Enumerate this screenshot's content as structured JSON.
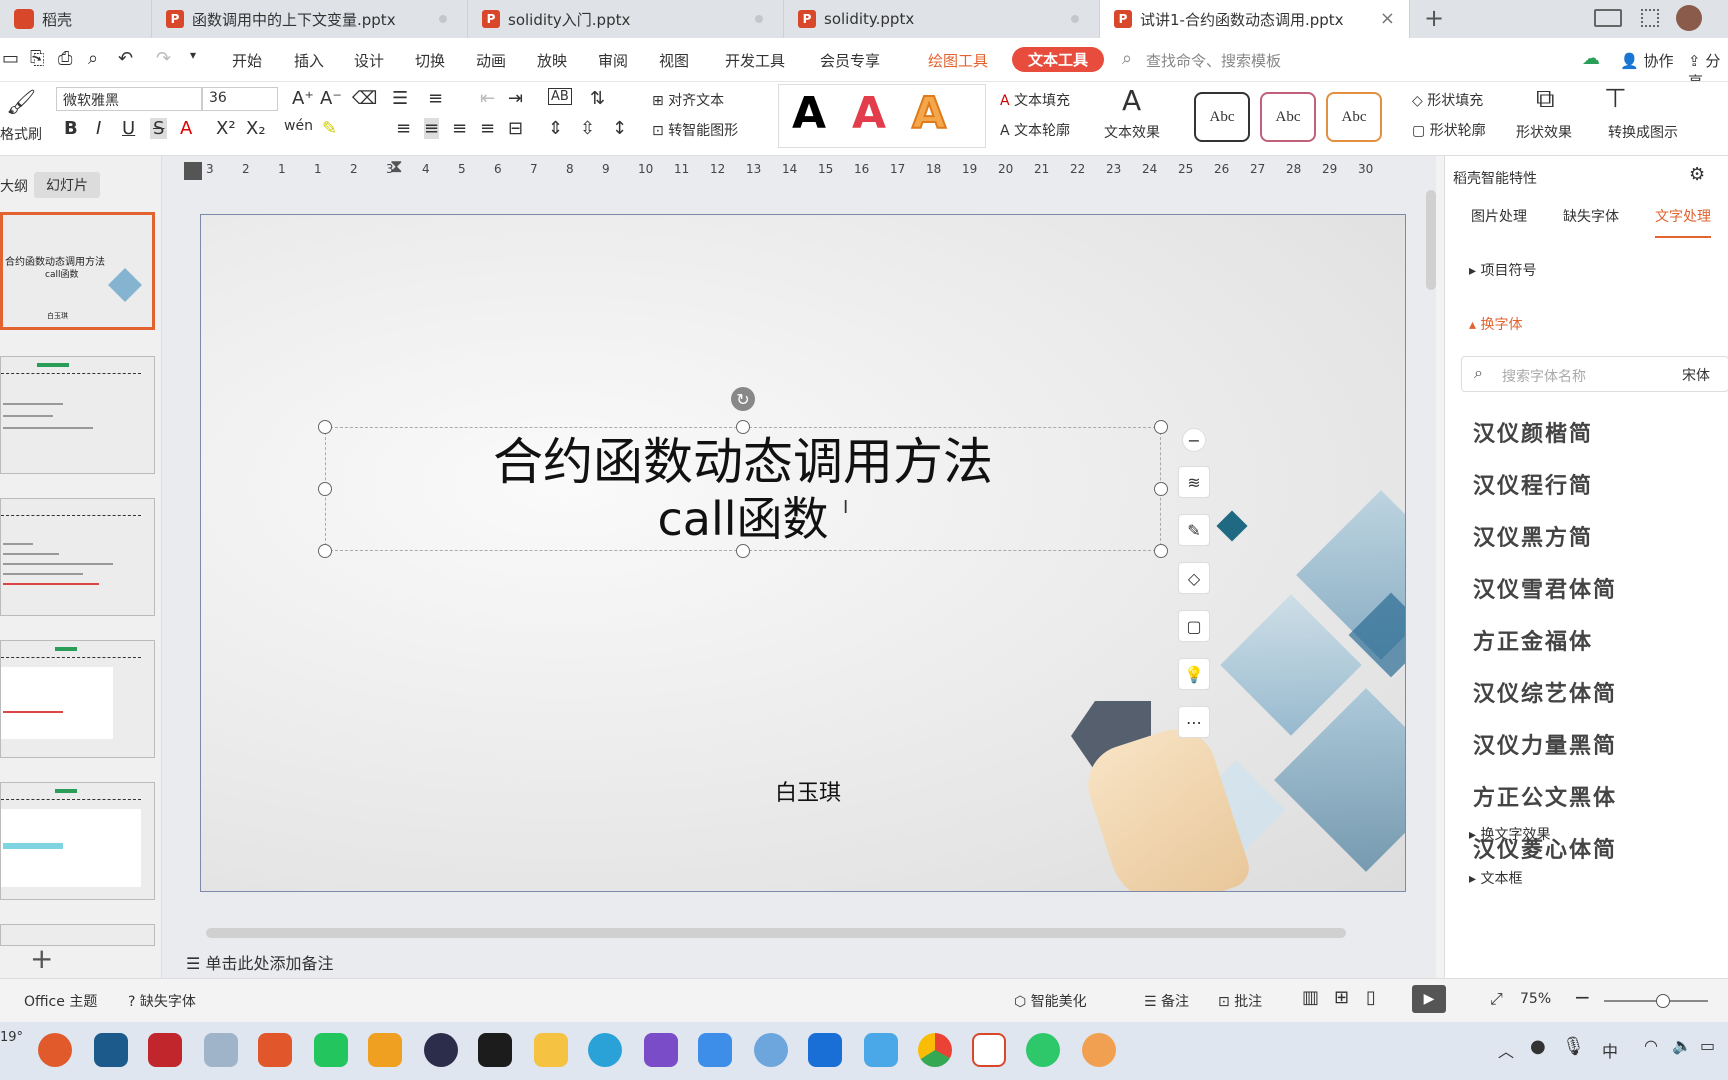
{
  "tabs": {
    "home": "稻壳",
    "t1": "函数调用中的上下文变量.pptx",
    "t2": "solidity入门.pptx",
    "t3": "solidity.pptx",
    "t4": "试讲1-合约函数动态调用.pptx",
    "badge_letter": "P",
    "add": "+"
  },
  "menu": {
    "start": "开始",
    "insert": "插入",
    "design": "设计",
    "switch": "切换",
    "anim": "动画",
    "show": "放映",
    "review": "审阅",
    "view": "视图",
    "dev": "开发工具",
    "member": "会员专享",
    "draw_tools": "绘图工具",
    "text_tools": "文本工具",
    "search_placeholder": "查找命令、搜索模板",
    "collab": "协作",
    "share": "分享"
  },
  "ribbon": {
    "format_painter": "格式刷",
    "font_name": "微软雅黑",
    "font_size": "36",
    "align_text": "对齐文本",
    "smart_shape": "转智能图形",
    "text_fill": "文本填充",
    "text_outline": "文本轮廓",
    "text_effect": "文本效果",
    "abc": "Abc",
    "shape_fill": "形状填充",
    "shape_outline": "形状轮廓",
    "shape_effect": "形状效果",
    "convert_chart": "转换成图示",
    "big_a": "A"
  },
  "left": {
    "outline": "大纲",
    "slides": "幻灯片",
    "add": "+"
  },
  "ruler": [
    "3",
    "2",
    "1",
    "1",
    "2",
    "3",
    "4",
    "5",
    "6",
    "7",
    "8",
    "9",
    "10",
    "11",
    "12",
    "13",
    "14",
    "15",
    "16",
    "17",
    "18",
    "19",
    "20",
    "21",
    "22",
    "23",
    "24",
    "25",
    "26",
    "27",
    "28",
    "29",
    "30"
  ],
  "slide": {
    "title_line1": "合约函数动态调用方法",
    "title_line2": "call函数",
    "author": "白玉琪",
    "cursor": "I",
    "thumb1_title": "合约函数动态调用方法",
    "thumb1_sub": "call函数",
    "thumb1_author": "白玉琪"
  },
  "notes": "单击此处添加备注",
  "right": {
    "header": "稻壳智能特性",
    "tab_img": "图片处理",
    "tab_font": "缺失字体",
    "tab_text": "文字处理",
    "bullets": "项目符号",
    "change_font": "换字体",
    "search_placeholder": "搜索字体名称",
    "current_font": "宋体",
    "fonts": [
      "汉仪颜楷简",
      "汉仪程行简",
      "汉仪黑方简",
      "汉仪雪君体简",
      "方正金福体",
      "汉仪综艺体简",
      "汉仪力量黑简",
      "方正公文黑体",
      "汉仪菱心体简"
    ],
    "change_effect": "换文字效果",
    "text_box": "文本框"
  },
  "status": {
    "theme": "Office 主题",
    "missing_font": "缺失字体",
    "beautify": "智能美化",
    "notes": "备注",
    "comments": "批注",
    "zoom": "75%"
  },
  "taskbar": {
    "temp": "19°",
    "ime": "中"
  },
  "colors": {
    "accent_orange": "#e2632f",
    "text_tools_red": "#e74c3c",
    "wps_red": "#d9472b",
    "blue_tab": "#1e6fd9"
  }
}
